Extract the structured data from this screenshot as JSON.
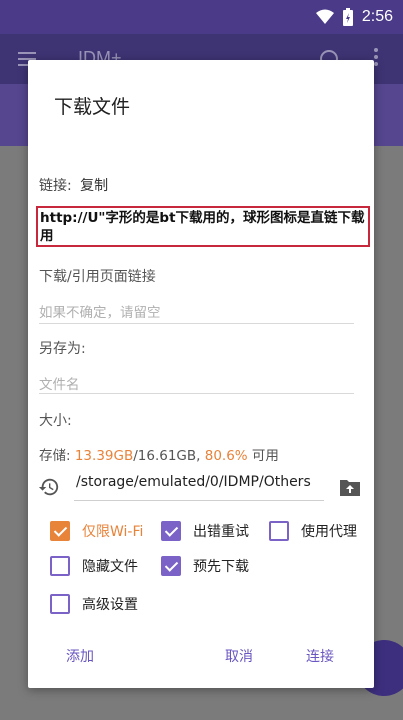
{
  "status_bar": {
    "time": "2:56"
  },
  "app_bar": {
    "title": "IDM+"
  },
  "dialog": {
    "title": "下载文件",
    "link_label": "链接:",
    "copy_label": "复制",
    "url_value": "http://U\"字形的是bt下载用的，球形图标是直链下载用",
    "referrer_label": "下载/引用页面链接",
    "referrer_placeholder": "如果不确定，请留空",
    "save_as_label": "另存为:",
    "filename_placeholder": "文件名",
    "size_label": "大小:",
    "storage": {
      "prefix": "存储: ",
      "free": "13.39GB",
      "total": "/16.61GB, ",
      "percent": "80.6%",
      "suffix": " 可用"
    },
    "path": "/storage/emulated/0/IDMP/Others",
    "options": [
      {
        "label": "仅限Wi-Fi",
        "checked": true
      },
      {
        "label": "出错重试",
        "checked": true
      },
      {
        "label": "使用代理",
        "checked": false
      },
      {
        "label": "隐藏文件",
        "checked": false
      },
      {
        "label": "预先下载",
        "checked": true
      },
      {
        "label": "高级设置",
        "checked": false
      }
    ],
    "actions": {
      "add": "添加",
      "cancel": "取消",
      "connect": "连接"
    }
  },
  "colors": {
    "accent": "#7a62c6",
    "warning": "#e8833a",
    "highlight_border": "#c8283b"
  }
}
